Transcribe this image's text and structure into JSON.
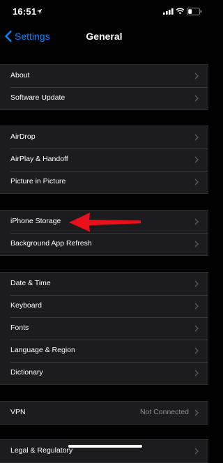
{
  "status": {
    "time": "16:51",
    "icons": [
      "location-icon",
      "signal-icon",
      "wifi-icon",
      "battery-icon"
    ]
  },
  "nav": {
    "back_label": "Settings",
    "title": "General"
  },
  "groups": [
    {
      "rows": [
        {
          "label": "About"
        },
        {
          "label": "Software Update"
        }
      ]
    },
    {
      "rows": [
        {
          "label": "AirDrop"
        },
        {
          "label": "AirPlay & Handoff"
        },
        {
          "label": "Picture in Picture"
        }
      ]
    },
    {
      "rows": [
        {
          "label": "iPhone Storage"
        },
        {
          "label": "Background App Refresh"
        }
      ]
    },
    {
      "rows": [
        {
          "label": "Date & Time"
        },
        {
          "label": "Keyboard"
        },
        {
          "label": "Fonts"
        },
        {
          "label": "Language & Region"
        },
        {
          "label": "Dictionary"
        }
      ]
    },
    {
      "rows": [
        {
          "label": "VPN",
          "value": "Not Connected"
        }
      ]
    },
    {
      "rows": [
        {
          "label": "Legal & Regulatory"
        }
      ]
    }
  ],
  "colors": {
    "accent": "#0a84ff",
    "annotation_arrow": "#e8101a",
    "cell_bg": "#1c1c1e",
    "background": "#000000"
  }
}
